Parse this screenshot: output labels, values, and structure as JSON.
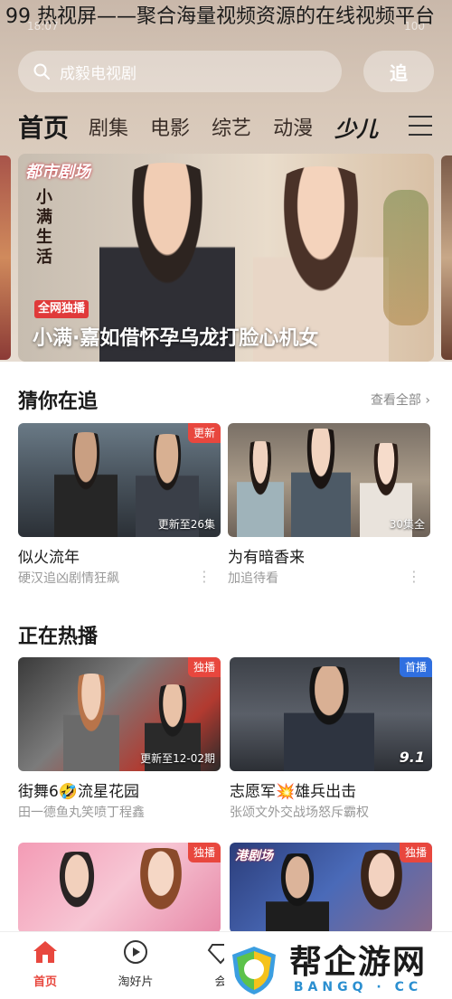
{
  "article_title": "99 热视屏——聚合海量视频资源的在线视频平台",
  "status_bar": {
    "time": "18:07",
    "battery": "100"
  },
  "search": {
    "placeholder": "成毅电视剧",
    "history_label": "追"
  },
  "nav": {
    "tabs": [
      "首页",
      "剧集",
      "电影",
      "综艺",
      "动漫"
    ],
    "kids_label": "少儿"
  },
  "banner": {
    "brand_logo": "都市剧场",
    "vertical_title": "小满生活",
    "badge": "全网独播",
    "title": "小满·嘉如借怀孕乌龙打脸心机女"
  },
  "section_follow": {
    "title": "猜你在追",
    "more": "查看全部",
    "cards": [
      {
        "tag": "更新",
        "episodes": "更新至26集",
        "name": "似火流年",
        "sub": "硬汉追凶剧情狂飙"
      },
      {
        "tag": "",
        "episodes": "30集全",
        "name": "为有暗香来",
        "sub": "加追待看"
      }
    ]
  },
  "section_hot": {
    "title": "正在热播",
    "cards": [
      {
        "tag": "独播",
        "tag_color": "#e8473e",
        "episodes": "更新至12-02期",
        "name": "街舞6🤣流星花园",
        "sub": "田一德鱼丸笑喷丁程鑫"
      },
      {
        "tag": "首播",
        "tag_color": "#2f6fe0",
        "score": "9.1",
        "name": "志愿军💥雄兵出击",
        "sub": "张颂文外交战场怒斥霸权"
      },
      {
        "tag": "独播",
        "tag_color": "#e8473e",
        "name": "",
        "sub": ""
      },
      {
        "tag": "独播",
        "tag_color": "#e8473e",
        "logo": "港剧场",
        "name": "",
        "sub": ""
      }
    ]
  },
  "bottom_nav": {
    "items": [
      "首页",
      "淘好片",
      "会"
    ]
  },
  "watermark": {
    "main": "帮企游网",
    "sub": "BANGQ · CC"
  },
  "colors": {
    "accent_red": "#e8473e",
    "accent_blue": "#2f6fe0"
  }
}
